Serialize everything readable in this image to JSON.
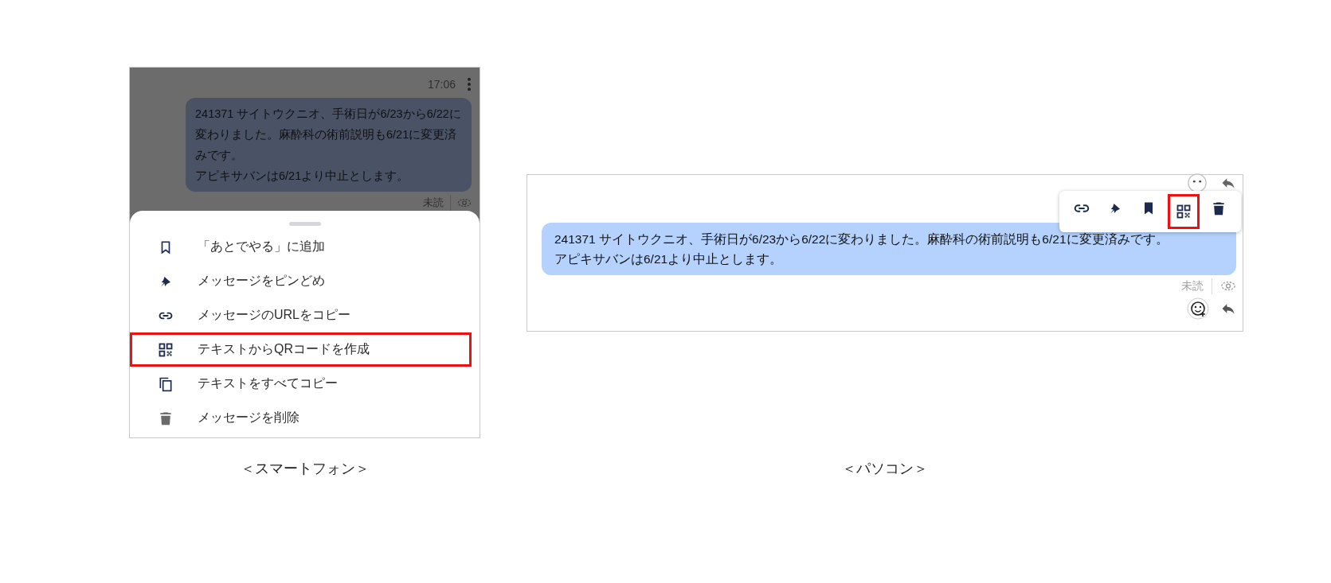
{
  "smartphone": {
    "time": "17:06",
    "message": {
      "lines": [
        "241371 サイトウクニオ、手術日が6/23から6/22に変わりました。麻酔科の術前説明も6/21に変更済みです。",
        "アピキサバンは6/21より中止とします。"
      ]
    },
    "read_status": "未読",
    "menu": [
      {
        "kind": "bookmark",
        "label": "「あとでやる」に追加",
        "highlighted": false
      },
      {
        "kind": "pin",
        "label": "メッセージをピンどめ",
        "highlighted": false
      },
      {
        "kind": "link",
        "label": "メッセージのURLをコピー",
        "highlighted": false
      },
      {
        "kind": "qr",
        "label": "テキストからQRコードを作成",
        "highlighted": true
      },
      {
        "kind": "copy",
        "label": "テキストをすべてコピー",
        "highlighted": false
      },
      {
        "kind": "trash",
        "label": "メッセージを削除",
        "highlighted": false
      }
    ],
    "caption": "＜スマートフォン＞"
  },
  "pc": {
    "toolbar": [
      {
        "kind": "link",
        "highlighted": false
      },
      {
        "kind": "pin",
        "highlighted": false
      },
      {
        "kind": "bookmark-filled",
        "highlighted": false
      },
      {
        "kind": "qr",
        "highlighted": true
      },
      {
        "kind": "trash",
        "highlighted": false
      }
    ],
    "message": {
      "lines": [
        "241371 サイトウクニオ、手術日が6/23から6/22に変わりました。麻酔科の術前説明も6/21に変更済みです。",
        "アピキサバンは6/21より中止とします。"
      ]
    },
    "read_status": "未読",
    "caption": "＜パソコン＞"
  }
}
